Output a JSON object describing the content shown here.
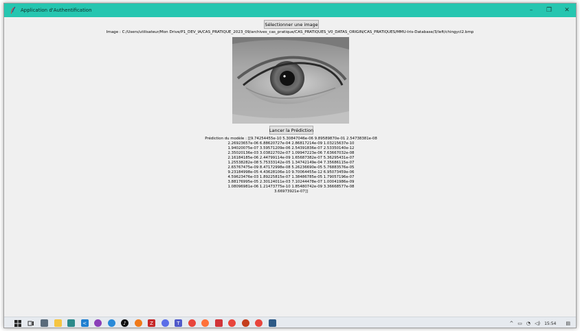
{
  "window": {
    "title": "Application d'Authentification",
    "controls": {
      "minimize": "–",
      "maximize": "❐",
      "close": "✕"
    }
  },
  "main": {
    "select_button": "Sélectionner une image",
    "image_path": "Image : C:/Users/utilisateur/Mon Drive/P1_DEV_IA/CAS_PRATIQUE_2023_09/archives_cas_pratique/CAS_PRATIQUES_V0_DATAS_ORIGIN/CAS_PRATIQUES/MMU-Iris-Database/3/left/chingycl2.bmp",
    "predict_button": "Lancer la Prédiction",
    "prediction_text": "Prédiction du modèle : [[9.74254455e-10 5.30847046e-06 9.89589870e-01 2.54738381e-08\n2.26923657e-06 6.88620727e-04 2.86817214e-09 1.03215637e-10\n1.94020075e-07 3.59571209e-06 2.54391836e-07 2.53350140e-12\n2.35020136e-03 3.03822702e-07 1.09947223e-06 7.63667032e-08\n2.16184185e-06 2.44799114e-09 1.65687382e-07 5.36295431e-07\n1.25538282e-08 5.75333142e-05 1.34742149e-04 7.35686115e-07\n2.65767475e-09 8.47172998e-08 5.26236690e-05 5.76883576e-05\n9.23184998e-05 4.43628106e-10 9.70064455e-12 6.95073459e-06\n4.59623476e-03 1.89225815e-07 1.38486785e-05 1.79057196e-07\n3.88176995e-05 2.30124011e-03 7.10244478e-07 1.00041986e-09\n1.08096981e-06 1.21473775e-10 1.85480742e-09 3.36668577e-08\n3.66973921e-07]]"
  },
  "taskbar": {
    "icons": [
      "windows-start-icon",
      "task-view-icon",
      "calculator-icon",
      "file-explorer-icon",
      "store-icon",
      "vscode-icon",
      "podcast-icon",
      "edge-icon",
      "tiktok-icon",
      "avast-icon",
      "filezilla-icon",
      "messenger-icon",
      "teams-icon",
      "chrome-icon",
      "firefox-icon",
      "outlook-icon",
      "chrome-icon",
      "powerpoint-icon",
      "chrome-icon",
      "python-app-icon"
    ],
    "clock": "15:54"
  }
}
